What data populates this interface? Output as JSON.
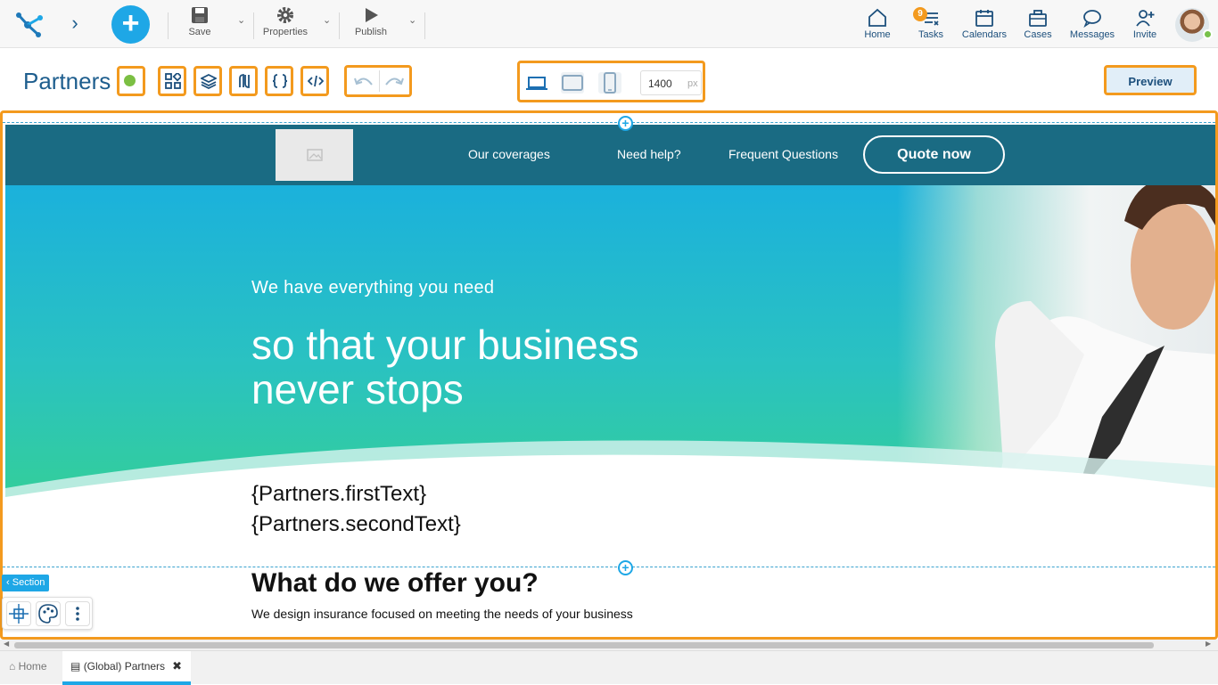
{
  "topbar": {
    "tools": {
      "save_label": "Save",
      "properties_label": "Properties",
      "publish_label": "Publish"
    },
    "nav": [
      {
        "label": "Home",
        "icon": "home-icon"
      },
      {
        "label": "Tasks",
        "icon": "tasks-icon"
      },
      {
        "label": "Calendars",
        "icon": "calendar-icon"
      },
      {
        "label": "Cases",
        "icon": "briefcase-icon"
      },
      {
        "label": "Messages",
        "icon": "chat-icon"
      },
      {
        "label": "Invite",
        "icon": "add-user-icon"
      }
    ],
    "tasks_badge": "9",
    "add_label": "+",
    "expand_label": "›"
  },
  "editor": {
    "title": "Partners",
    "width_value": "1400",
    "width_unit": "px",
    "preview_label": "Preview"
  },
  "site": {
    "nav_links": [
      "Our coverages",
      "Need help?",
      "Frequent Questions"
    ],
    "quote_button": "Quote now",
    "hero_kicker": "We have everything you need",
    "hero_title_line1": "so that your business",
    "hero_title_line2": "never stops",
    "template_line1": "{Partners.firstText}",
    "template_line2": "{Partners.secondText}",
    "offer_title": "What do we offer you?",
    "offer_text": "We design insurance focused on meeting the needs of your business"
  },
  "section_tag": "Section",
  "tabs": {
    "home": "Home",
    "partners": "(Global) Partners",
    "close": "✖"
  },
  "colors": {
    "accent": "#1ea7e6",
    "highlight": "#f39a1e",
    "primary_text": "#1e5e8e",
    "nav_bg": "#1a6b83"
  }
}
